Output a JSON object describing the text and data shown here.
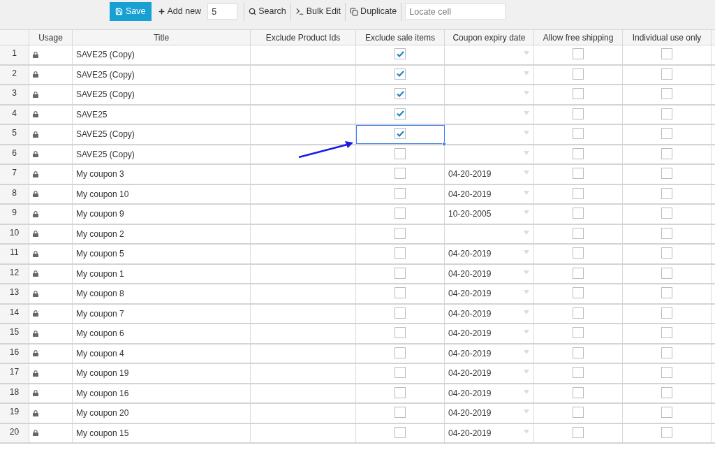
{
  "toolbar": {
    "save": "Save",
    "add_new": "Add new",
    "add_count": "5",
    "search": "Search",
    "bulk_edit": "Bulk Edit",
    "duplicate": "Duplicate",
    "locate": {
      "placeholder": "Locate cell"
    }
  },
  "table": {
    "columns": [
      "Usage",
      "Title",
      "Exclude Product Ids",
      "Exclude sale items",
      "Coupon expiry date",
      "Allow free shipping",
      "Individual use only"
    ],
    "rows": [
      {
        "number": "1",
        "title": "SAVE25 (Copy)",
        "exclude_sale_items": {
          "checked": true,
          "selected": false
        },
        "allow_free_shipping": false,
        "individual_use_only": false
      },
      {
        "number": "2",
        "title": "SAVE25 (Copy)",
        "exclude_sale_items": {
          "checked": true,
          "selected": false
        },
        "allow_free_shipping": false,
        "individual_use_only": false
      },
      {
        "number": "3",
        "title": "SAVE25 (Copy)",
        "exclude_sale_items": {
          "checked": true,
          "selected": false
        },
        "allow_free_shipping": false,
        "individual_use_only": false
      },
      {
        "number": "4",
        "title": "SAVE25",
        "exclude_sale_items": {
          "checked": true,
          "selected": false
        },
        "allow_free_shipping": false,
        "individual_use_only": false
      },
      {
        "number": "5",
        "title": "SAVE25 (Copy)",
        "exclude_sale_items": {
          "checked": true,
          "selected": true
        },
        "allow_free_shipping": false,
        "individual_use_only": false
      },
      {
        "number": "6",
        "title": "SAVE25 (Copy)",
        "exclude_sale_items": {
          "checked": false,
          "selected": false
        },
        "allow_free_shipping": false,
        "individual_use_only": false
      },
      {
        "number": "7",
        "title": "My coupon 3",
        "exclude_sale_items": {
          "checked": false,
          "selected": false
        },
        "expiry_date": "04-20-2019",
        "allow_free_shipping": false,
        "individual_use_only": false
      },
      {
        "number": "8",
        "title": "My coupon 10",
        "exclude_sale_items": {
          "checked": false,
          "selected": false
        },
        "expiry_date": "04-20-2019",
        "allow_free_shipping": false,
        "individual_use_only": false
      },
      {
        "number": "9",
        "title": "My coupon 9",
        "exclude_sale_items": {
          "checked": false,
          "selected": false
        },
        "expiry_date": "10-20-2005",
        "allow_free_shipping": false,
        "individual_use_only": false
      },
      {
        "number": "10",
        "title": "My coupon 2",
        "exclude_sale_items": {
          "checked": false,
          "selected": false
        },
        "allow_free_shipping": false,
        "individual_use_only": false
      },
      {
        "number": "11",
        "title": "My coupon 5",
        "exclude_sale_items": {
          "checked": false,
          "selected": false
        },
        "expiry_date": "04-20-2019",
        "allow_free_shipping": false,
        "individual_use_only": false
      },
      {
        "number": "12",
        "title": "My coupon 1",
        "exclude_sale_items": {
          "checked": false,
          "selected": false
        },
        "expiry_date": "04-20-2019",
        "allow_free_shipping": false,
        "individual_use_only": false
      },
      {
        "number": "13",
        "title": "My coupon 8",
        "exclude_sale_items": {
          "checked": false,
          "selected": false
        },
        "expiry_date": "04-20-2019",
        "allow_free_shipping": false,
        "individual_use_only": false
      },
      {
        "number": "14",
        "title": "My coupon 7",
        "exclude_sale_items": {
          "checked": false,
          "selected": false
        },
        "expiry_date": "04-20-2019",
        "allow_free_shipping": false,
        "individual_use_only": false
      },
      {
        "number": "15",
        "title": "My coupon 6",
        "exclude_sale_items": {
          "checked": false,
          "selected": false
        },
        "expiry_date": "04-20-2019",
        "allow_free_shipping": false,
        "individual_use_only": false
      },
      {
        "number": "16",
        "title": "My coupon 4",
        "exclude_sale_items": {
          "checked": false,
          "selected": false
        },
        "expiry_date": "04-20-2019",
        "allow_free_shipping": false,
        "individual_use_only": false
      },
      {
        "number": "17",
        "title": "My coupon 19",
        "exclude_sale_items": {
          "checked": false,
          "selected": false
        },
        "expiry_date": "04-20-2019",
        "allow_free_shipping": false,
        "individual_use_only": false
      },
      {
        "number": "18",
        "title": "My coupon 16",
        "exclude_sale_items": {
          "checked": false,
          "selected": false
        },
        "expiry_date": "04-20-2019",
        "allow_free_shipping": false,
        "individual_use_only": false
      },
      {
        "number": "19",
        "title": "My coupon 20",
        "exclude_sale_items": {
          "checked": false,
          "selected": false
        },
        "expiry_date": "04-20-2019",
        "allow_free_shipping": false,
        "individual_use_only": false
      },
      {
        "number": "20",
        "title": "My coupon 15",
        "exclude_sale_items": {
          "checked": false,
          "selected": false
        },
        "expiry_date": "04-20-2019",
        "allow_free_shipping": false,
        "individual_use_only": false
      }
    ]
  }
}
